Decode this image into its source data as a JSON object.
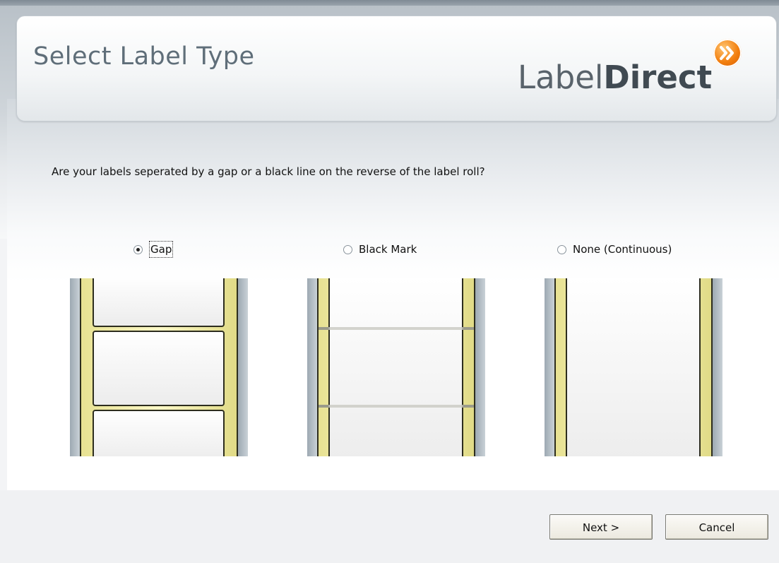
{
  "header": {
    "title": "Select Label Type",
    "logo_prefix": "Label",
    "logo_bold": "Direct",
    "logo_badge_icon": "double-chevron-right-icon",
    "brand_color": "#f27e0e"
  },
  "question": "Are your labels seperated by a gap or a black line on the reverse of the label roll?",
  "options": [
    {
      "label": "Gap",
      "selected": true,
      "illustration": "gap-roll"
    },
    {
      "label": "Black Mark",
      "selected": false,
      "illustration": "black-mark-roll"
    },
    {
      "label": "None (Continuous)",
      "selected": false,
      "illustration": "continuous-roll"
    }
  ],
  "buttons": {
    "next": "Next >",
    "cancel": "Cancel"
  }
}
